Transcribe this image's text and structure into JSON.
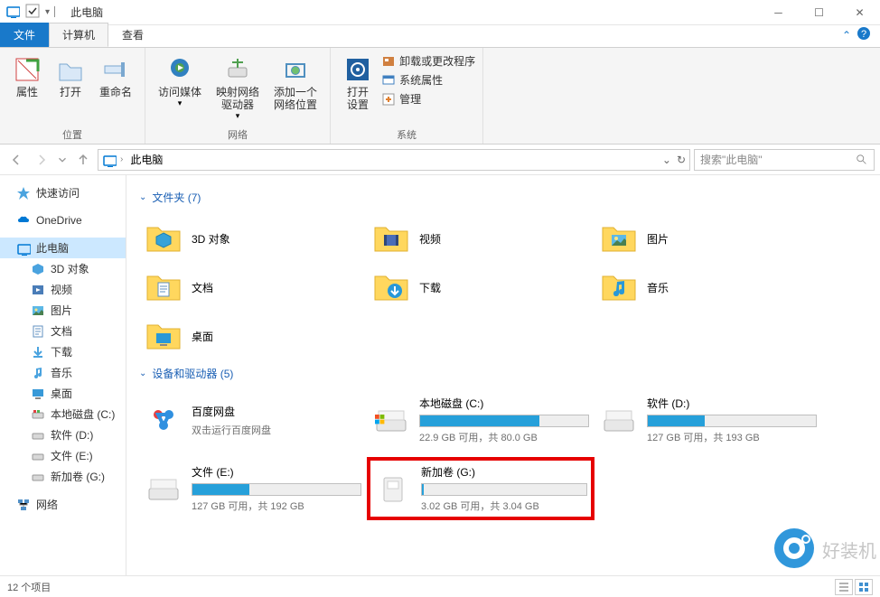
{
  "title": "此电脑",
  "tabs": {
    "file": "文件",
    "computer": "计算机",
    "view": "查看"
  },
  "ribbon": {
    "location": {
      "props": "属性",
      "open": "打开",
      "rename": "重命名",
      "group": "位置"
    },
    "network": {
      "media": "访问媒体",
      "map": "映射网络\n驱动器",
      "addloc": "添加一个\n网络位置",
      "group": "网络"
    },
    "system": {
      "opensettings": "打开\n设置",
      "uninstall": "卸载或更改程序",
      "sysprops": "系统属性",
      "manage": "管理",
      "group": "系统"
    }
  },
  "nav": {
    "crumb": "此电脑",
    "search_placeholder": "搜索\"此电脑\""
  },
  "tree": {
    "quick": "快速访问",
    "onedrive": "OneDrive",
    "thispc": "此电脑",
    "objects3d": "3D 对象",
    "videos": "视频",
    "pictures": "图片",
    "documents": "文档",
    "downloads": "下载",
    "music": "音乐",
    "desktop": "桌面",
    "diskc": "本地磁盘 (C:)",
    "diskd": "软件 (D:)",
    "diske": "文件 (E:)",
    "diskg": "新加卷 (G:)",
    "network": "网络"
  },
  "groups": {
    "folders": "文件夹 (7)",
    "devices": "设备和驱动器 (5)"
  },
  "folders": {
    "objects3d": "3D 对象",
    "videos": "视频",
    "pictures": "图片",
    "documents": "文档",
    "downloads": "下载",
    "music": "音乐",
    "desktop": "桌面"
  },
  "drives": {
    "baidu": {
      "name": "百度网盘",
      "sub": "双击运行百度网盘"
    },
    "c": {
      "name": "本地磁盘 (C:)",
      "text": "22.9 GB 可用，共 80.0 GB",
      "pct": 71
    },
    "d": {
      "name": "软件 (D:)",
      "text": "127 GB 可用，共 193 GB",
      "pct": 34
    },
    "e": {
      "name": "文件 (E:)",
      "text": "127 GB 可用，共 192 GB",
      "pct": 34
    },
    "g": {
      "name": "新加卷 (G:)",
      "text": "3.02 GB 可用，共 3.04 GB",
      "pct": 1
    }
  },
  "status": "12 个项目",
  "watermark": "好装机"
}
